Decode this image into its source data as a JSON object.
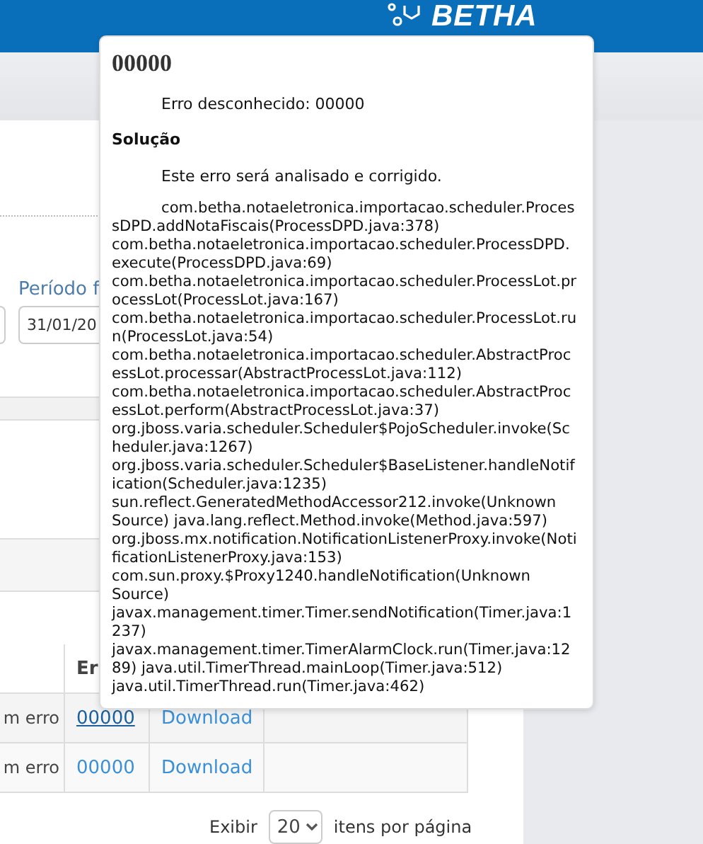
{
  "header": {
    "logo": "BETHA"
  },
  "filter": {
    "label": "Período f",
    "date_value": "31/01/20"
  },
  "table": {
    "columns": [
      "Er"
    ],
    "rows": [
      {
        "status": "m erro",
        "error_code": "00000",
        "hovered": true,
        "action": "Download"
      },
      {
        "status": "m erro",
        "error_code": "00000",
        "hovered": false,
        "action": "Download"
      }
    ]
  },
  "pagination": {
    "show_label": "Exibir",
    "page_size": "20",
    "per_page_label": "itens por página"
  },
  "popover": {
    "title": "00000",
    "message": "Erro desconhecido: 00000",
    "solution_heading": "Solução",
    "solution": "Este erro será analisado e corrigido.",
    "stack_trace": "com.betha.notaeletronica.importacao.scheduler.ProcessDPD.addNotaFiscais(ProcessDPD.java:378) com.betha.notaeletronica.importacao.scheduler.ProcessDPD.execute(ProcessDPD.java:69) com.betha.notaeletronica.importacao.scheduler.ProcessLot.processLot(ProcessLot.java:167) com.betha.notaeletronica.importacao.scheduler.ProcessLot.run(ProcessLot.java:54) com.betha.notaeletronica.importacao.scheduler.AbstractProcessLot.processar(AbstractProcessLot.java:112) com.betha.notaeletronica.importacao.scheduler.AbstractProcessLot.perform(AbstractProcessLot.java:37) org.jboss.varia.scheduler.Scheduler$PojoScheduler.invoke(Scheduler.java:1267) org.jboss.varia.scheduler.Scheduler$BaseListener.handleNotification(Scheduler.java:1235) sun.reflect.GeneratedMethodAccessor212.invoke(Unknown Source) java.lang.reflect.Method.invoke(Method.java:597) org.jboss.mx.notification.NotificationListenerProxy.invoke(NotificationListenerProxy.java:153) com.sun.proxy.$Proxy1240.handleNotification(Unknown Source) javax.management.timer.Timer.sendNotification(Timer.java:1237) javax.management.timer.TimerAlarmClock.run(Timer.java:1289) java.util.TimerThread.mainLoop(Timer.java:512) java.util.TimerThread.run(Timer.java:462)"
  }
}
